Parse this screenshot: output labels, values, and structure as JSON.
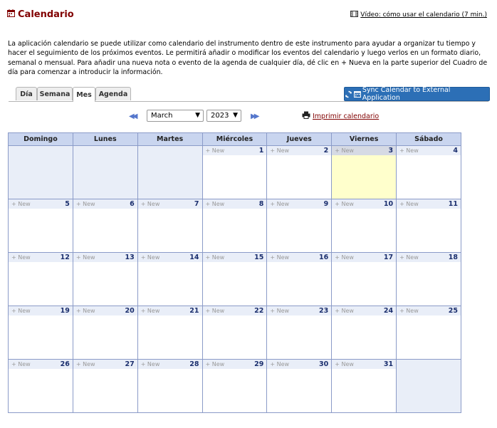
{
  "header": {
    "title": "Calendario",
    "video_link": "Vídeo: cómo usar el calendario (7 min.)"
  },
  "intro": "La aplicación calendario se puede utilizar como calendario del instrumento dentro de este instrumento para ayudar a organizar tu tiempo y hacer el seguimiento de los próximos eventos. Le permitirá añadir o modificar los eventos del calendario y luego verlos en un formato diario, semanal o mensual. Para añadir una nueva nota o evento de la agenda de cualquier día, dé clic en + Nueva en la parte superior del Cuadro de día para comenzar a introducir la información.",
  "tabs": [
    "Día",
    "Semana",
    "Mes",
    "Agenda"
  ],
  "active_tab": "Mes",
  "sync_button": "Sync Calendar to External Application",
  "nav": {
    "month": "March",
    "year": "2023",
    "print": "Imprimir calendario"
  },
  "weekdays": [
    "Domingo",
    "Lunes",
    "Martes",
    "Miércoles",
    "Jueves",
    "Viernes",
    "Sábado"
  ],
  "new_label": "+ New",
  "today": 3,
  "weeks": [
    [
      null,
      null,
      null,
      1,
      2,
      3,
      4
    ],
    [
      5,
      6,
      7,
      8,
      9,
      10,
      11
    ],
    [
      12,
      13,
      14,
      15,
      16,
      17,
      18
    ],
    [
      19,
      20,
      21,
      22,
      23,
      24,
      25
    ],
    [
      26,
      27,
      28,
      29,
      30,
      31,
      null
    ]
  ],
  "colors": {
    "title": "#800000",
    "header_bg": "#c9d5ef",
    "today_bg": "#ffffcc",
    "button": "#2c6fb6"
  }
}
